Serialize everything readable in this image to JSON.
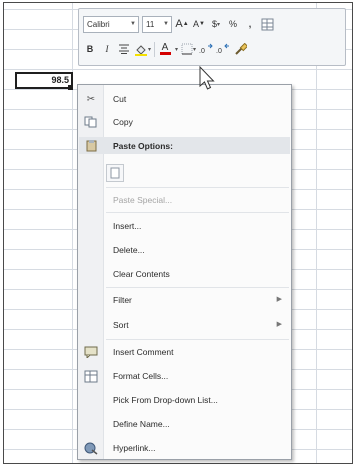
{
  "cell": {
    "value": "98.5"
  },
  "minibar": {
    "font_name": "Calibri",
    "font_size": "11",
    "grow_font": "A",
    "shrink_font": "A",
    "currency": "$",
    "percent": "%",
    "comma": ",",
    "bold": "B",
    "italic": "I",
    "font_color": "A"
  },
  "menu": {
    "cut": "Cut",
    "copy": "Copy",
    "paste_options": "Paste Options:",
    "paste_special": "Paste Special...",
    "insert": "Insert...",
    "delete": "Delete...",
    "clear_contents": "Clear Contents",
    "filter": "Filter",
    "sort": "Sort",
    "insert_comment": "Insert Comment",
    "format_cells": "Format Cells...",
    "pick_from_list": "Pick From Drop-down List...",
    "define_name": "Define Name...",
    "hyperlink": "Hyperlink..."
  }
}
